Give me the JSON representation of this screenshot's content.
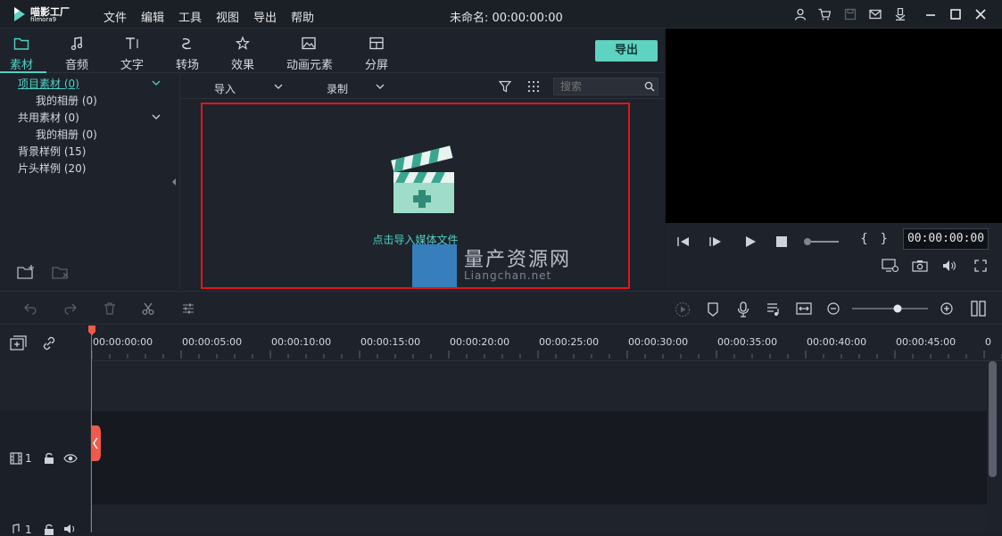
{
  "app": {
    "brand": "喵影工厂",
    "brand_sub": "filmora9",
    "doc_title": "未命名: 00:00:00:00"
  },
  "menu": [
    "文件",
    "编辑",
    "工具",
    "视图",
    "导出",
    "帮助"
  ],
  "title_icons": [
    "user-icon",
    "cart-icon",
    "save-icon",
    "mail-icon",
    "download-icon",
    "minimize-icon",
    "maximize-icon",
    "close-icon"
  ],
  "categories": [
    {
      "label": "素材",
      "icon": "folder-icon",
      "active": true
    },
    {
      "label": "音频",
      "icon": "music-icon"
    },
    {
      "label": "文字",
      "icon": "text-icon"
    },
    {
      "label": "转场",
      "icon": "transition-icon"
    },
    {
      "label": "效果",
      "icon": "effects-icon"
    },
    {
      "label": "动画元素",
      "icon": "image-icon"
    },
    {
      "label": "分屏",
      "icon": "split-screen-icon"
    }
  ],
  "export_label": "导出",
  "tree": [
    {
      "label": "项目素材 (0)",
      "active": true
    },
    {
      "label": "我的相册 (0)"
    },
    {
      "label": "共用素材 (0)"
    },
    {
      "label": "我的相册 (0)"
    },
    {
      "label": "背景样例 (15)"
    },
    {
      "label": "片头样例 (20)"
    }
  ],
  "media_toolbar": {
    "import_label": "导入",
    "record_label": "录制",
    "search_placeholder": "搜索"
  },
  "drop_area": {
    "text": "点击导入媒体文件"
  },
  "watermark": {
    "title": "量产资源网",
    "sub": "Liangchan.net"
  },
  "preview": {
    "time": "00:00:00:00",
    "brackets": "{   }"
  },
  "ruler": {
    "labels": [
      "00:00:00:00",
      "00:00:05:00",
      "00:00:10:00",
      "00:00:15:00",
      "00:00:20:00",
      "00:00:25:00",
      "00:00:30:00",
      "00:00:35:00",
      "00:00:40:00",
      "00:00:45:00",
      "0"
    ]
  },
  "tracks": {
    "video_label": "1",
    "audio_label": "1"
  },
  "colors": {
    "accent": "#4fd1c5",
    "export_bg": "#5fd3c2",
    "highlight_border": "#e0161b",
    "playhead": "#f05a4a"
  }
}
